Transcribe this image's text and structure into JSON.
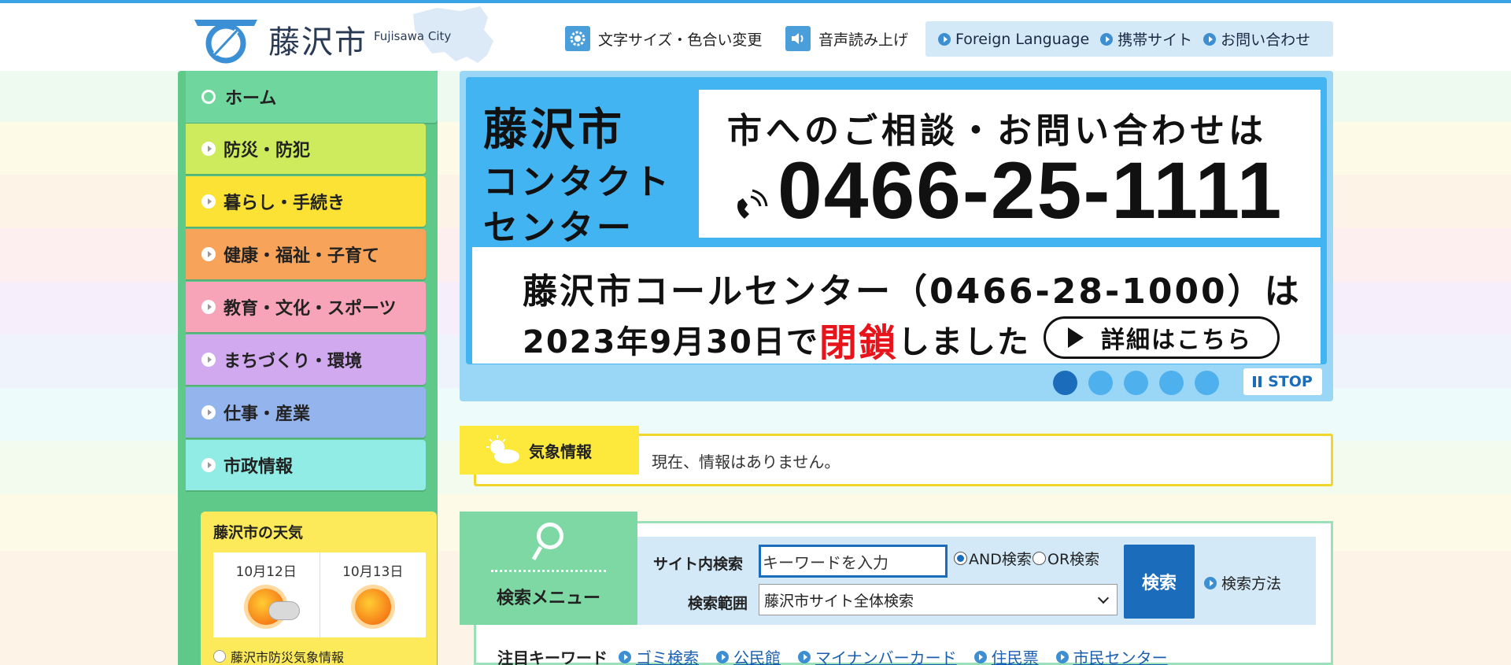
{
  "header": {
    "logo_name": "藤沢市",
    "logo_en": "Fujisawa City",
    "text_size_label": "文字サイズ・色合い変更",
    "voice_label": "音声読み上げ",
    "links": [
      {
        "label": "Foreign Language"
      },
      {
        "label": "携帯サイト"
      },
      {
        "label": "お問い合わせ"
      }
    ]
  },
  "sidebar": {
    "home": "ホーム",
    "items": [
      {
        "label": "防災・防犯",
        "color": "#cdeb5c"
      },
      {
        "label": "暮らし・手続き",
        "color": "#fbe234"
      },
      {
        "label": "健康・福祉・子育て",
        "color": "#f8a35a"
      },
      {
        "label": "教育・文化・スポーツ",
        "color": "#f7a3b8"
      },
      {
        "label": "まちづくり・環境",
        "color": "#d1a9ef"
      },
      {
        "label": "仕事・産業",
        "color": "#94b4ee"
      },
      {
        "label": "市政情報",
        "color": "#90ece4"
      }
    ],
    "weather": {
      "title": "藤沢市の天気",
      "days": [
        {
          "date": "10月12日",
          "icon": "sun-cloud-icon"
        },
        {
          "date": "10月13日",
          "icon": "sun-icon"
        }
      ],
      "link": "藤沢市防災気象情報"
    }
  },
  "banner": {
    "left_line1": "藤沢市",
    "left_line2": "コンタクト",
    "left_line3": "センター",
    "top_line1": "市へのご相談・お問い合わせは",
    "phone": "0466-25-1111",
    "bottom_line1": "藤沢市コールセンター（0466-28-1000）は",
    "bottom_line2_a": "2023年9月30日で",
    "bottom_line2_red": "閉鎖",
    "bottom_line2_b": "しました",
    "detail_button": "詳細はこちら",
    "slides": 5,
    "active_slide": 1,
    "stop_label": "STOP"
  },
  "weather_info": {
    "tab_label": "気象情報",
    "message": "現在、情報はありません。"
  },
  "search": {
    "tab_label": "検索メニュー",
    "site_search_label": "サイト内検索",
    "input_placeholder": "キーワードを入力",
    "and_label": "AND検索",
    "or_label": "OR検索",
    "scope_label": "検索範囲",
    "scope_value": "藤沢市サイト全体検索",
    "search_button": "検索",
    "help_link": "検索方法",
    "keywords_label": "注目キーワード",
    "keywords": [
      "ゴミ検索",
      "公民館",
      "マイナンバーカード",
      "住民票",
      "市民センター"
    ]
  }
}
